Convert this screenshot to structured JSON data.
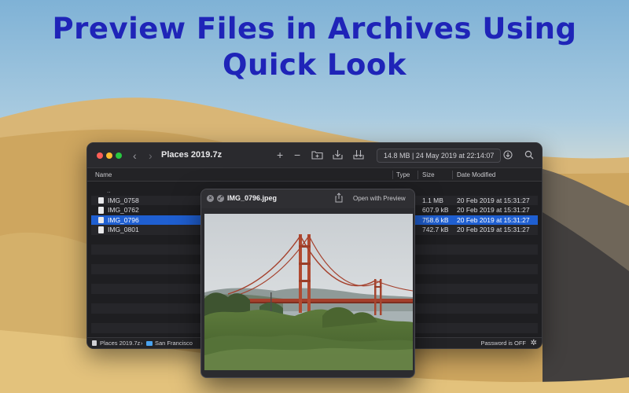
{
  "headline": {
    "line1": "Preview Files in Archives Using",
    "line2": "Quick Look"
  },
  "window": {
    "title": "Places 2019.7z",
    "info": "14.8 MB | 24 May 2019 at 22:14:07",
    "columns": {
      "name": "Name",
      "type": "Type",
      "size": "Size",
      "date": "Date Modified"
    },
    "rows": [
      {
        "name": "..",
        "size": "",
        "date": "",
        "parent": true
      },
      {
        "name": "IMG_0758",
        "size": "1.1 MB",
        "date": "20 Feb 2019 at 15:31:27"
      },
      {
        "name": "IMG_0762",
        "size": "607.9 kB",
        "date": "20 Feb 2019 at 15:31:27"
      },
      {
        "name": "IMG_0796",
        "size": "758.6 kB",
        "date": "20 Feb 2019 at 15:31:27",
        "selected": true
      },
      {
        "name": "IMG_0801",
        "size": "742.7 kB",
        "date": "20 Feb 2019 at 15:31:27"
      }
    ],
    "status": {
      "archive": "Places 2019.7z",
      "separator": "›",
      "folder": "San Francisco",
      "password": "Password is OFF"
    }
  },
  "quicklook": {
    "title": "IMG_0796.jpeg",
    "open_label": "Open with Preview"
  },
  "icons": {
    "add": "+",
    "remove": "−",
    "back": "‹",
    "forward": "›",
    "search": "⌕",
    "gear": "✲"
  },
  "colors": {
    "headline": "#1f24b8",
    "selection": "#1f5fd1",
    "window_bg": "#1e1e21"
  }
}
